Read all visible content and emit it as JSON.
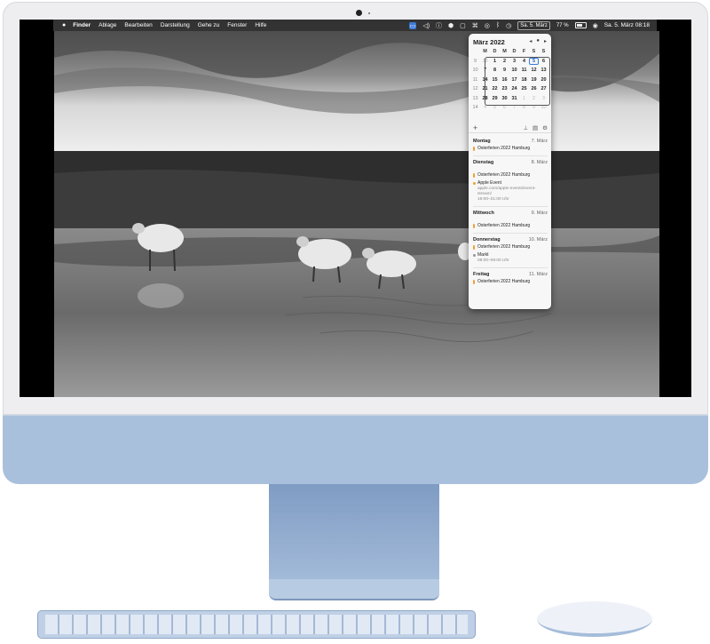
{
  "menubar": {
    "apple": "",
    "items": [
      "Finder",
      "Ablage",
      "Bearbeiten",
      "Darstellung",
      "Gehe zu",
      "Fenster",
      "Hilfe"
    ],
    "date_chip": "Sa. 5. März",
    "battery": "77 %",
    "clock": "Sa. 5. März  08:18",
    "icons": [
      "monitor-icon",
      "volume-icon",
      "info-icon",
      "hexagon-icon",
      "clipboard-icon",
      "command-icon",
      "globe-icon",
      "bluetooth-icon",
      "clock-icon",
      "cloud-icon",
      "wifi-icon",
      "siri-icon"
    ]
  },
  "calendar": {
    "month_title": "März 2022",
    "nav": [
      "◂",
      "●",
      "▸"
    ],
    "weekday_headers": [
      "M",
      "D",
      "M",
      "D",
      "F",
      "S",
      "S"
    ],
    "weeks": [
      {
        "wk": "9",
        "days": [
          "28",
          "1",
          "2",
          "3",
          "4",
          "5",
          "6"
        ]
      },
      {
        "wk": "10",
        "days": [
          "7",
          "8",
          "9",
          "10",
          "11",
          "12",
          "13"
        ]
      },
      {
        "wk": "11",
        "days": [
          "14",
          "15",
          "16",
          "17",
          "18",
          "19",
          "20"
        ]
      },
      {
        "wk": "12",
        "days": [
          "21",
          "22",
          "23",
          "24",
          "25",
          "26",
          "27"
        ]
      },
      {
        "wk": "13",
        "days": [
          "28",
          "29",
          "30",
          "31",
          "1",
          "2",
          "3"
        ]
      },
      {
        "wk": "14",
        "days": [
          "4",
          "5",
          "6",
          "7",
          "8",
          "9",
          "10"
        ]
      }
    ],
    "toolbar": {
      "add": "+",
      "pin": "⊥",
      "calendar": "▤",
      "settings": "⚙"
    },
    "agenda": [
      {
        "day": "Montag",
        "date": "7. März",
        "events": [
          {
            "title": "Osterferien 2022 Hamburg"
          }
        ]
      },
      {
        "day": "Dienstag",
        "date": "8. März",
        "events": [
          {
            "title": "Osterferien 2022 Hamburg"
          },
          {
            "title": "Apple Event",
            "sub1": "apple.com/apple-events/event-",
            "sub2": "stream/",
            "time": "19:00–21:00 Uhr"
          }
        ]
      },
      {
        "day": "Mittwoch",
        "date": "9. März",
        "events": [
          {
            "title": "Osterferien 2022 Hamburg"
          }
        ]
      },
      {
        "day": "Donnerstag",
        "date": "10. März",
        "events": [
          {
            "title": "Osterferien 2022 Hamburg"
          },
          {
            "title": "Markt",
            "time": "08:00–09:00 Uhr"
          }
        ]
      },
      {
        "day": "Freitag",
        "date": "11. März",
        "events": [
          {
            "title": "Osterferien 2022 Hamburg"
          }
        ]
      }
    ]
  }
}
